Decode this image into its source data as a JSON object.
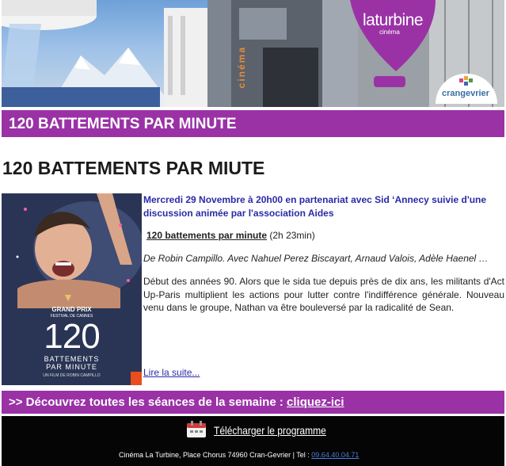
{
  "banner": {
    "logo_text": "laturbine",
    "logo_sub": "cinéma",
    "building_sign": "cinéma",
    "partner_logo": "crangevrier"
  },
  "title_bar": {
    "text": "120 BATTEMENTS PAR MINUTE"
  },
  "main_title": "120 BATTEMENTS PAR MIUTE",
  "poster": {
    "grand_prix": "GRAND PRIX",
    "festival": "FESTIVAL DE CANNES",
    "number": "120",
    "sub1": "BATTEMENTS",
    "sub2": "PAR MINUTE",
    "director": "UN FILM DE ROBIN CAMPILLO"
  },
  "event": {
    "line": "Mercredi 29 Novembre à 20h00 en partenariat avec Sid ‘Annecy suivie d'une discussion animée par l'association Aides"
  },
  "film": {
    "title": "120 battements par minute",
    "duration": "(2h 23min)",
    "cast": "De Robin Campillo. Avec Nahuel Perez Biscayart, Arnaud Valois, Adèle Haenel …",
    "synopsis": "Début des années 90. Alors que le sida tue depuis près de dix ans, les militants d'Act Up-Paris multiplient les actions pour lutter contre l'indifférence générale. Nouveau venu dans le groupe, Nathan va être bouleversé par la radicalité de Sean.",
    "read_more": "Lire la suite..."
  },
  "seances": {
    "text": ">> Découvrez toutes les séances de la semaine : ",
    "link": "cliquez-ici"
  },
  "footer": {
    "download": "Télécharger le programme",
    "address": "Cinéma La Turbine, Place Chorus 74960 Cran-Gevrier | Tel : ",
    "phone": "09.64.40.04.71"
  },
  "colors": {
    "purple": "#9a32a6",
    "link_blue": "#2a2aa8",
    "footer_bg": "#050505"
  }
}
